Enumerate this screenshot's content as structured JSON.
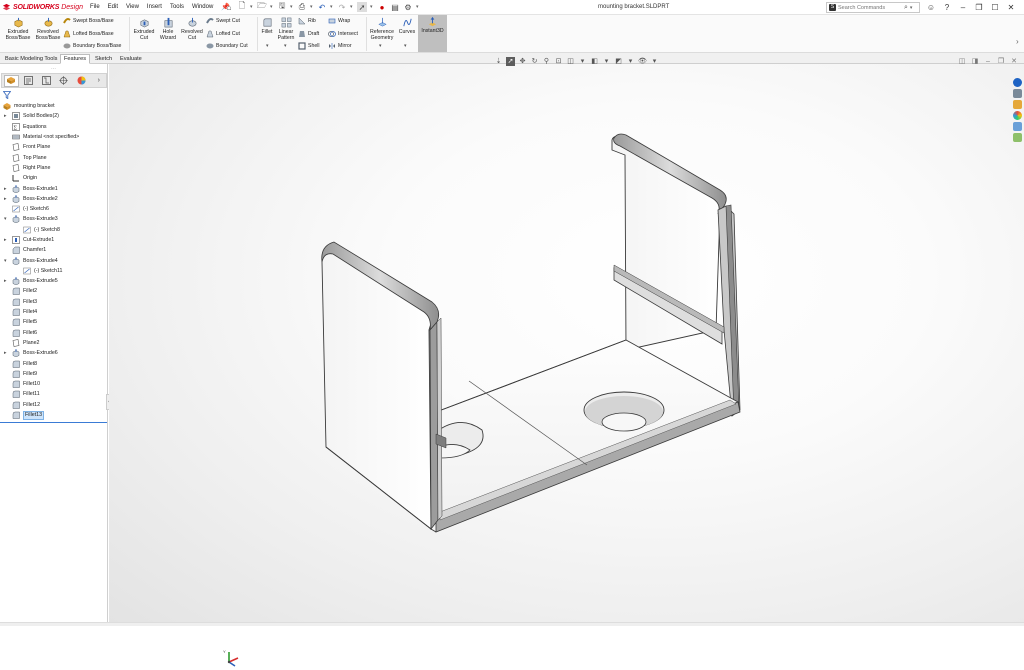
{
  "app": {
    "brand_bold": "SOLIDWORKS",
    "brand_light": "Design",
    "document_title": "mounting bracket.SLDPRT",
    "colors": {
      "brand": "#d6001c",
      "accent": "#3a7bd5",
      "selection_bg": "#cde4fb"
    }
  },
  "menu": [
    "File",
    "Edit",
    "View",
    "Insert",
    "Tools",
    "Window"
  ],
  "search": {
    "placeholder": "Search Commands"
  },
  "ribbon": {
    "extruded_boss": "Extruded\nBoss/Base",
    "revolved_boss": "Revolved\nBoss/Base",
    "swept_boss": "Swept Boss/Base",
    "lofted_boss": "Lofted Boss/Base",
    "boundary_boss": "Boundary Boss/Base",
    "extruded_cut": "Extruded\nCut",
    "hole_wizard": "Hole\nWizard",
    "revolved_cut": "Revolved\nCut",
    "swept_cut": "Swept Cut",
    "lofted_cut": "Lofted Cut",
    "boundary_cut": "Boundary Cut",
    "fillet": "Fillet",
    "linear_pattern": "Linear\nPattern",
    "rib": "Rib",
    "draft": "Draft",
    "shell": "Shell",
    "wrap": "Wrap",
    "intersect": "Intersect",
    "mirror": "Mirror",
    "reference_geometry": "Reference\nGeometry",
    "curves": "Curves",
    "instant3d": "Instant3D"
  },
  "tabs": [
    {
      "label": "Basic Modeling Tools"
    },
    {
      "label": "Features",
      "active": true
    },
    {
      "label": "Sketch"
    },
    {
      "label": "Evaluate"
    }
  ],
  "tree": [
    {
      "label": "mounting bracket",
      "icon": "part-icon",
      "indent": 0,
      "expander": ""
    },
    {
      "label": "Solid Bodies(2)",
      "icon": "solid-bodies-icon",
      "indent": 1,
      "expander": "▸"
    },
    {
      "label": "Equations",
      "icon": "equations-icon",
      "indent": 1,
      "expander": ""
    },
    {
      "label": "Material <not specified>",
      "icon": "material-icon",
      "indent": 1,
      "expander": ""
    },
    {
      "label": "Front Plane",
      "icon": "plane-icon",
      "indent": 1,
      "expander": ""
    },
    {
      "label": "Top Plane",
      "icon": "plane-icon",
      "indent": 1,
      "expander": ""
    },
    {
      "label": "Right Plane",
      "icon": "plane-icon",
      "indent": 1,
      "expander": ""
    },
    {
      "label": "Origin",
      "icon": "origin-icon",
      "indent": 1,
      "expander": ""
    },
    {
      "label": "Boss-Extrude1",
      "icon": "extrude-icon",
      "indent": 1,
      "expander": "▸"
    },
    {
      "label": "Boss-Extrude2",
      "icon": "extrude-icon",
      "indent": 1,
      "expander": "▸"
    },
    {
      "label": "(-) Sketch6",
      "icon": "sketch-icon",
      "indent": 1,
      "expander": ""
    },
    {
      "label": "Boss-Extrude3",
      "icon": "extrude-icon",
      "indent": 1,
      "expander": "▾"
    },
    {
      "label": "(-) Sketch8",
      "icon": "sketch-icon",
      "indent": 2,
      "expander": ""
    },
    {
      "label": "Cut-Extrude1",
      "icon": "cut-icon",
      "indent": 1,
      "expander": "▸"
    },
    {
      "label": "Chamfer1",
      "icon": "chamfer-icon",
      "indent": 1,
      "expander": ""
    },
    {
      "label": "Boss-Extrude4",
      "icon": "extrude-icon",
      "indent": 1,
      "expander": "▾"
    },
    {
      "label": "(-) Sketch11",
      "icon": "sketch-icon",
      "indent": 2,
      "expander": ""
    },
    {
      "label": "Boss-Extrude5",
      "icon": "extrude-icon",
      "indent": 1,
      "expander": "▸"
    },
    {
      "label": "Fillet2",
      "icon": "fillet-icon",
      "indent": 1,
      "expander": ""
    },
    {
      "label": "Fillet3",
      "icon": "fillet-icon",
      "indent": 1,
      "expander": ""
    },
    {
      "label": "Fillet4",
      "icon": "fillet-icon",
      "indent": 1,
      "expander": ""
    },
    {
      "label": "Fillet5",
      "icon": "fillet-icon",
      "indent": 1,
      "expander": ""
    },
    {
      "label": "Fillet6",
      "icon": "fillet-icon",
      "indent": 1,
      "expander": ""
    },
    {
      "label": "Plane2",
      "icon": "plane-icon",
      "indent": 1,
      "expander": ""
    },
    {
      "label": "Boss-Extrude6",
      "icon": "extrude-icon",
      "indent": 1,
      "expander": "▸"
    },
    {
      "label": "Fillet8",
      "icon": "fillet-icon",
      "indent": 1,
      "expander": ""
    },
    {
      "label": "Fillet9",
      "icon": "fillet-icon",
      "indent": 1,
      "expander": ""
    },
    {
      "label": "Fillet10",
      "icon": "fillet-icon",
      "indent": 1,
      "expander": ""
    },
    {
      "label": "Fillet11",
      "icon": "fillet-icon",
      "indent": 1,
      "expander": ""
    },
    {
      "label": "Fillet12",
      "icon": "fillet-icon",
      "indent": 1,
      "expander": ""
    },
    {
      "label": "Fillet13",
      "icon": "fillet-icon",
      "indent": 1,
      "expander": "",
      "selected": true
    }
  ]
}
